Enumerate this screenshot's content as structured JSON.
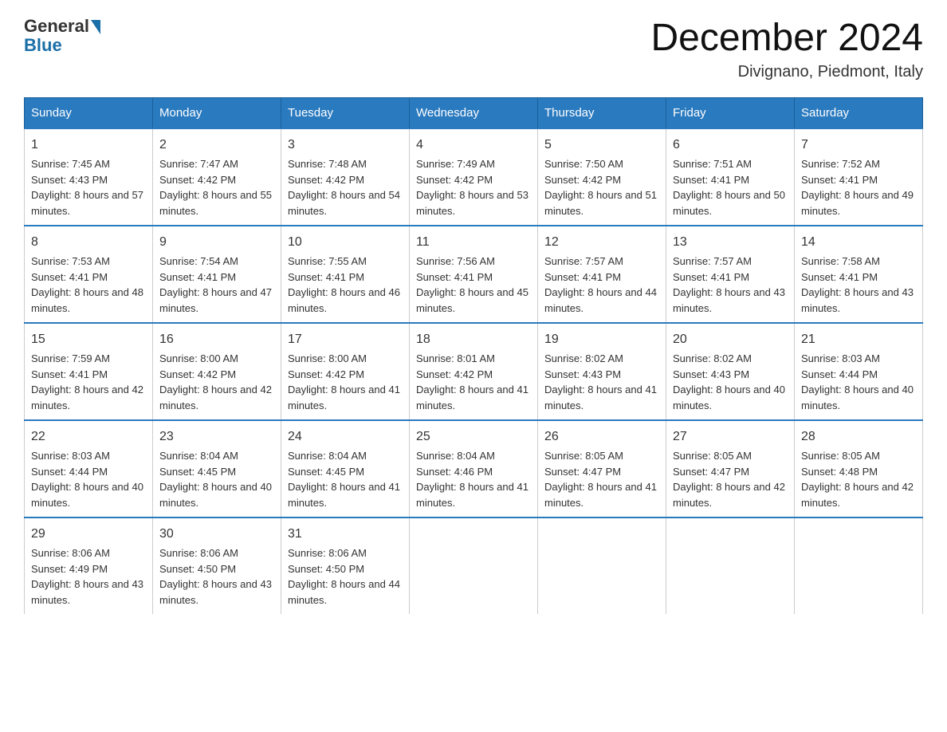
{
  "logo": {
    "general": "General",
    "blue": "Blue"
  },
  "title": "December 2024",
  "subtitle": "Divignano, Piedmont, Italy",
  "days_of_week": [
    "Sunday",
    "Monday",
    "Tuesday",
    "Wednesday",
    "Thursday",
    "Friday",
    "Saturday"
  ],
  "weeks": [
    [
      {
        "day": "1",
        "sunrise": "7:45 AM",
        "sunset": "4:43 PM",
        "daylight": "8 hours and 57 minutes."
      },
      {
        "day": "2",
        "sunrise": "7:47 AM",
        "sunset": "4:42 PM",
        "daylight": "8 hours and 55 minutes."
      },
      {
        "day": "3",
        "sunrise": "7:48 AM",
        "sunset": "4:42 PM",
        "daylight": "8 hours and 54 minutes."
      },
      {
        "day": "4",
        "sunrise": "7:49 AM",
        "sunset": "4:42 PM",
        "daylight": "8 hours and 53 minutes."
      },
      {
        "day": "5",
        "sunrise": "7:50 AM",
        "sunset": "4:42 PM",
        "daylight": "8 hours and 51 minutes."
      },
      {
        "day": "6",
        "sunrise": "7:51 AM",
        "sunset": "4:41 PM",
        "daylight": "8 hours and 50 minutes."
      },
      {
        "day": "7",
        "sunrise": "7:52 AM",
        "sunset": "4:41 PM",
        "daylight": "8 hours and 49 minutes."
      }
    ],
    [
      {
        "day": "8",
        "sunrise": "7:53 AM",
        "sunset": "4:41 PM",
        "daylight": "8 hours and 48 minutes."
      },
      {
        "day": "9",
        "sunrise": "7:54 AM",
        "sunset": "4:41 PM",
        "daylight": "8 hours and 47 minutes."
      },
      {
        "day": "10",
        "sunrise": "7:55 AM",
        "sunset": "4:41 PM",
        "daylight": "8 hours and 46 minutes."
      },
      {
        "day": "11",
        "sunrise": "7:56 AM",
        "sunset": "4:41 PM",
        "daylight": "8 hours and 45 minutes."
      },
      {
        "day": "12",
        "sunrise": "7:57 AM",
        "sunset": "4:41 PM",
        "daylight": "8 hours and 44 minutes."
      },
      {
        "day": "13",
        "sunrise": "7:57 AM",
        "sunset": "4:41 PM",
        "daylight": "8 hours and 43 minutes."
      },
      {
        "day": "14",
        "sunrise": "7:58 AM",
        "sunset": "4:41 PM",
        "daylight": "8 hours and 43 minutes."
      }
    ],
    [
      {
        "day": "15",
        "sunrise": "7:59 AM",
        "sunset": "4:41 PM",
        "daylight": "8 hours and 42 minutes."
      },
      {
        "day": "16",
        "sunrise": "8:00 AM",
        "sunset": "4:42 PM",
        "daylight": "8 hours and 42 minutes."
      },
      {
        "day": "17",
        "sunrise": "8:00 AM",
        "sunset": "4:42 PM",
        "daylight": "8 hours and 41 minutes."
      },
      {
        "day": "18",
        "sunrise": "8:01 AM",
        "sunset": "4:42 PM",
        "daylight": "8 hours and 41 minutes."
      },
      {
        "day": "19",
        "sunrise": "8:02 AM",
        "sunset": "4:43 PM",
        "daylight": "8 hours and 41 minutes."
      },
      {
        "day": "20",
        "sunrise": "8:02 AM",
        "sunset": "4:43 PM",
        "daylight": "8 hours and 40 minutes."
      },
      {
        "day": "21",
        "sunrise": "8:03 AM",
        "sunset": "4:44 PM",
        "daylight": "8 hours and 40 minutes."
      }
    ],
    [
      {
        "day": "22",
        "sunrise": "8:03 AM",
        "sunset": "4:44 PM",
        "daylight": "8 hours and 40 minutes."
      },
      {
        "day": "23",
        "sunrise": "8:04 AM",
        "sunset": "4:45 PM",
        "daylight": "8 hours and 40 minutes."
      },
      {
        "day": "24",
        "sunrise": "8:04 AM",
        "sunset": "4:45 PM",
        "daylight": "8 hours and 41 minutes."
      },
      {
        "day": "25",
        "sunrise": "8:04 AM",
        "sunset": "4:46 PM",
        "daylight": "8 hours and 41 minutes."
      },
      {
        "day": "26",
        "sunrise": "8:05 AM",
        "sunset": "4:47 PM",
        "daylight": "8 hours and 41 minutes."
      },
      {
        "day": "27",
        "sunrise": "8:05 AM",
        "sunset": "4:47 PM",
        "daylight": "8 hours and 42 minutes."
      },
      {
        "day": "28",
        "sunrise": "8:05 AM",
        "sunset": "4:48 PM",
        "daylight": "8 hours and 42 minutes."
      }
    ],
    [
      {
        "day": "29",
        "sunrise": "8:06 AM",
        "sunset": "4:49 PM",
        "daylight": "8 hours and 43 minutes."
      },
      {
        "day": "30",
        "sunrise": "8:06 AM",
        "sunset": "4:50 PM",
        "daylight": "8 hours and 43 minutes."
      },
      {
        "day": "31",
        "sunrise": "8:06 AM",
        "sunset": "4:50 PM",
        "daylight": "8 hours and 44 minutes."
      },
      null,
      null,
      null,
      null
    ]
  ],
  "labels": {
    "sunrise": "Sunrise:",
    "sunset": "Sunset:",
    "daylight": "Daylight:"
  }
}
